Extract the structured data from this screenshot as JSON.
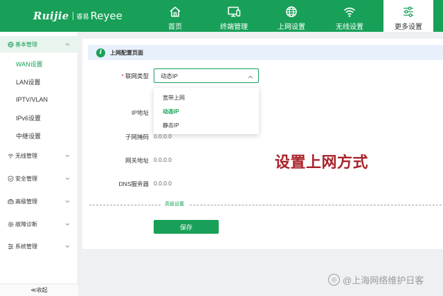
{
  "brand": {
    "name_left": "Ruijie",
    "name_mark": "睿易",
    "name_right": "Reyee"
  },
  "nav": {
    "items": [
      {
        "label": "首页",
        "icon": "home-icon"
      },
      {
        "label": "终端管理",
        "icon": "monitor-icon"
      },
      {
        "label": "上网设置",
        "icon": "globe-icon"
      },
      {
        "label": "无线设置",
        "icon": "wifi-icon"
      },
      {
        "label": "更多设置",
        "icon": "sliders-icon",
        "active": true
      }
    ]
  },
  "sidebar": {
    "groups": [
      {
        "label": "基本管理",
        "icon": "globe-icon",
        "expanded": true,
        "items": [
          "WAN设置",
          "LAN设置",
          "IPTV/VLAN",
          "IPv6设置",
          "中继设置"
        ],
        "active_item": "WAN设置"
      },
      {
        "label": "无线管理",
        "icon": "wifi-icon"
      },
      {
        "label": "安全管理",
        "icon": "shield-icon"
      },
      {
        "label": "高级管理",
        "icon": "briefcase-icon"
      },
      {
        "label": "故障诊断",
        "icon": "gear-icon"
      },
      {
        "label": "系统管理",
        "icon": "list-icon"
      }
    ],
    "collapse_label": "≪收起"
  },
  "content": {
    "section_title": "上网配置页面",
    "info_icon_text": "i",
    "required_mark": "*",
    "connection_type": {
      "label": "联网类型",
      "value": "动态IP",
      "options": [
        "宽带上网",
        "动态IP",
        "静态IP"
      ],
      "selected": "动态IP"
    },
    "fields": [
      {
        "label": "IP地址",
        "value": ""
      },
      {
        "label": "子网掩码",
        "value": "0.0.0.0"
      },
      {
        "label": "网关地址",
        "value": "0.0.0.0"
      },
      {
        "label": "DNS服务器",
        "value": "0.0.0.0"
      }
    ],
    "advanced_label": "高级设置",
    "save_label": "保存"
  },
  "overlay_caption": "设置上网方式",
  "watermark": {
    "icon_text": "◎",
    "text": "@上海网络维护日客"
  },
  "colors": {
    "primary": "#18a058",
    "accent_text": "#a8232a",
    "info_bar": "#e8f1fb"
  }
}
